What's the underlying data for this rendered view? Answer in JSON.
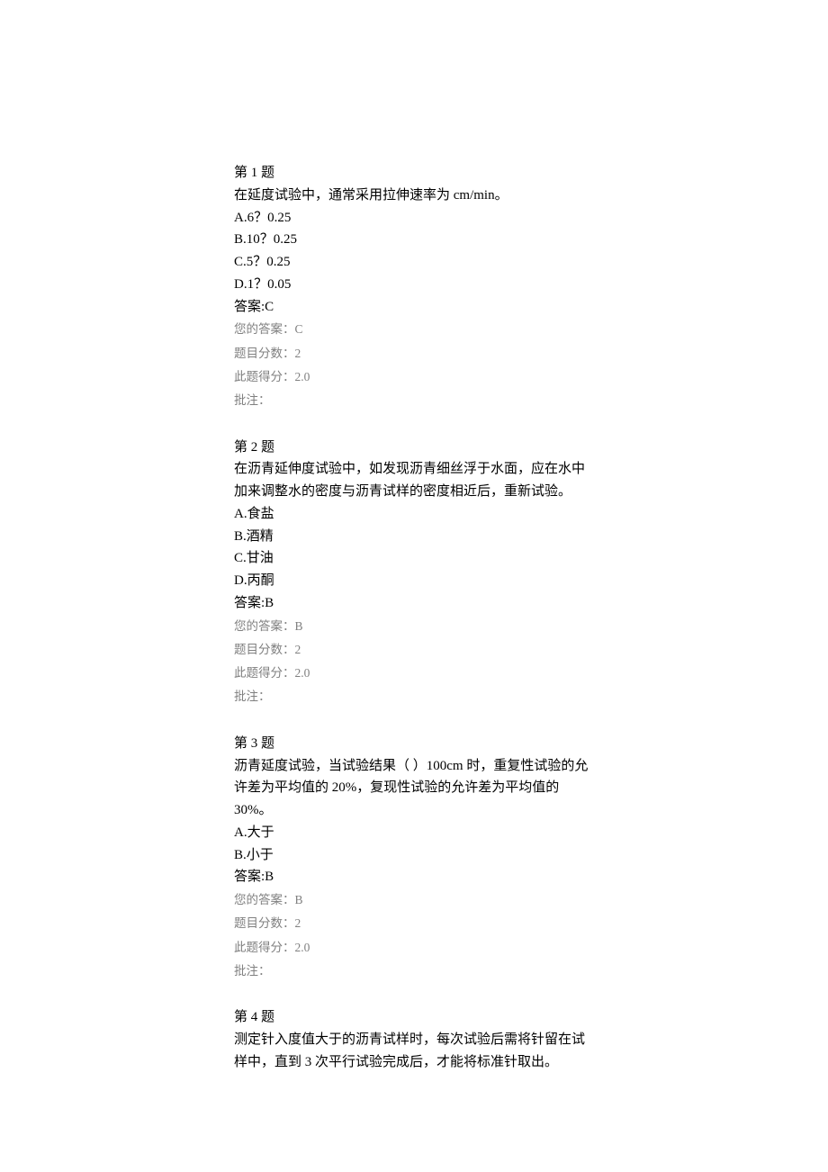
{
  "questions": [
    {
      "header": "第 1 题",
      "stem": "在延度试验中，通常采用拉伸速率为 cm/min。",
      "choices": [
        "A.6？0.25",
        "B.10？0.25",
        "C.5？0.25",
        "D.1？0.05"
      ],
      "answer_line": "答案:C",
      "meta": {
        "your_answer": "您的答案：C",
        "score_total": "题目分数：2",
        "score_got": "此题得分：2.0",
        "comment": "批注："
      }
    },
    {
      "header": "第 2 题",
      "stem": "在沥青延伸度试验中，如发现沥青细丝浮于水面，应在水中加来调整水的密度与沥青试样的密度相近后，重新试验。",
      "choices": [
        "A.食盐",
        "B.酒精",
        "C.甘油",
        "D.丙酮"
      ],
      "answer_line": "答案:B",
      "meta": {
        "your_answer": "您的答案：B",
        "score_total": "题目分数：2",
        "score_got": "此题得分：2.0",
        "comment": "批注："
      }
    },
    {
      "header": "第 3 题",
      "stem": "沥青延度试验，当试验结果（ ）100cm 时，重复性试验的允许差为平均值的 20%，复现性试验的允许差为平均值的 30%。",
      "choices": [
        "A.大于",
        "B.小于"
      ],
      "answer_line": "答案:B",
      "meta": {
        "your_answer": "您的答案：B",
        "score_total": "题目分数：2",
        "score_got": "此题得分：2.0",
        "comment": "批注："
      }
    },
    {
      "header": "第 4 题",
      "stem": "测定针入度值大于的沥青试样时，每次试验后需将针留在试样中，直到 3 次平行试验完成后，才能将标准针取出。",
      "choices": [],
      "answer_line": "",
      "meta": null
    }
  ]
}
